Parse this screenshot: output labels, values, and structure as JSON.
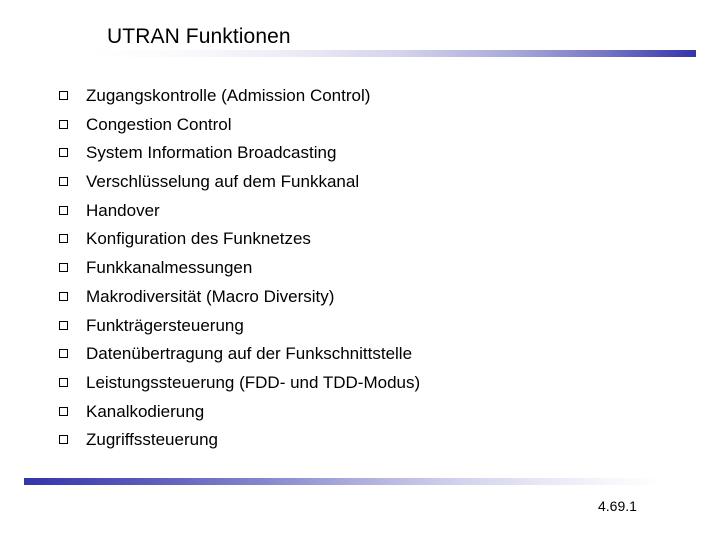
{
  "slide": {
    "title": "UTRAN Funktionen",
    "page_number": "4.69.1",
    "bullet_marker_icon": "hollow-square-bullet-icon",
    "accent_color": "#3434ac",
    "background_color": "#ffffff",
    "text_color": "#000000",
    "items": [
      {
        "label": "Zugangskontrolle (Admission Control)"
      },
      {
        "label": "Congestion Control"
      },
      {
        "label": "System Information Broadcasting"
      },
      {
        "label": "Verschlüsselung auf dem Funkkanal"
      },
      {
        "label": "Handover"
      },
      {
        "label": "Konfiguration des Funknetzes"
      },
      {
        "label": "Funkkanalmessungen"
      },
      {
        "label": "Makrodiversität (Macro Diversity)"
      },
      {
        "label": "Funkträgersteuerung"
      },
      {
        "label": "Datenübertragung auf der Funkschnittstelle"
      },
      {
        "label": "Leistungssteuerung (FDD- und TDD-Modus)"
      },
      {
        "label": "Kanalkodierung"
      },
      {
        "label": "Zugriffssteuerung"
      }
    ]
  }
}
